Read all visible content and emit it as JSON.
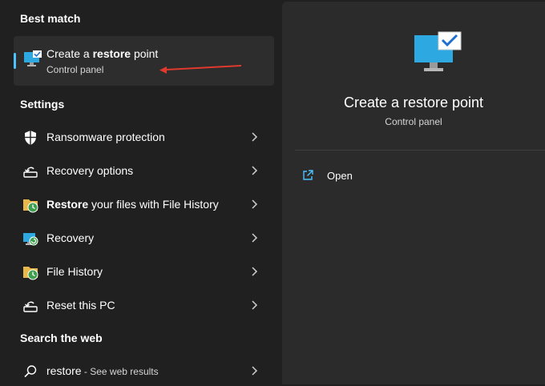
{
  "best_match": {
    "heading": "Best match",
    "title_pre": "Create a ",
    "title_bold": "restore",
    "title_post": " point",
    "subtitle": "Control panel"
  },
  "settings": {
    "heading": "Settings",
    "items": [
      {
        "label_bold": "",
        "label": "Ransomware protection",
        "icon": "shield-icon"
      },
      {
        "label_bold": "",
        "label": "Recovery options",
        "icon": "recovery-icon"
      },
      {
        "label_bold": "Restore",
        "label": " your files with File History",
        "icon": "file-history-icon"
      },
      {
        "label_bold": "",
        "label": "Recovery",
        "icon": "recovery-monitor-icon"
      },
      {
        "label_bold": "",
        "label": "File History",
        "icon": "file-history-icon"
      },
      {
        "label_bold": "",
        "label": "Reset this PC",
        "icon": "reset-pc-icon"
      }
    ]
  },
  "web": {
    "heading": "Search the web",
    "query": "restore",
    "suffix": " - See web results"
  },
  "preview": {
    "title": "Create a restore point",
    "subtitle": "Control panel",
    "action_label": "Open"
  },
  "colors": {
    "accent": "#4cc2ff",
    "annotation_arrow": "#e0392e"
  }
}
